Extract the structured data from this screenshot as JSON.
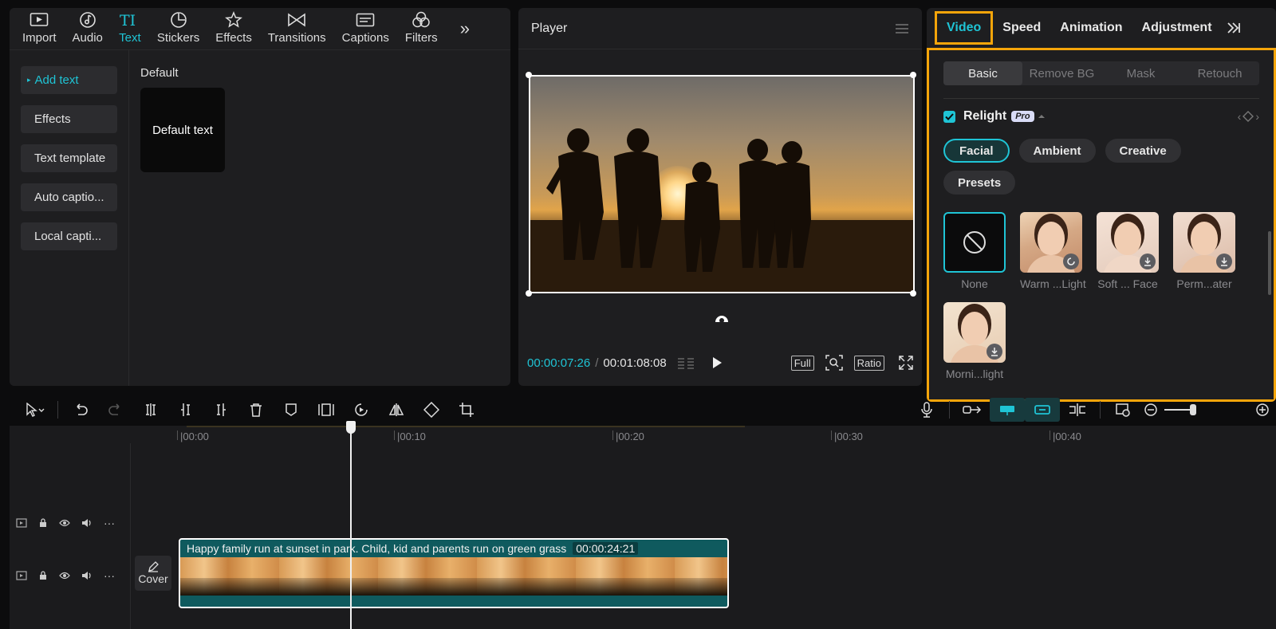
{
  "media": {
    "tabs": [
      {
        "label": "Import",
        "icon": "import-icon"
      },
      {
        "label": "Audio",
        "icon": "audio-icon"
      },
      {
        "label": "Text",
        "icon": "text-icon"
      },
      {
        "label": "Stickers",
        "icon": "stickers-icon"
      },
      {
        "label": "Effects",
        "icon": "effects-icon"
      },
      {
        "label": "Transitions",
        "icon": "transitions-icon"
      },
      {
        "label": "Captions",
        "icon": "captions-icon"
      },
      {
        "label": "Filters",
        "icon": "filters-icon"
      }
    ],
    "active_tab": "Text",
    "sidebar": [
      "Add text",
      "Effects",
      "Text template",
      "Auto captio...",
      "Local capti..."
    ],
    "section_label": "Default",
    "card_label": "Default text"
  },
  "player": {
    "title": "Player",
    "current_time": "00:00:07:26",
    "total_time": "00:01:08:08",
    "full_label": "Full",
    "ratio_label": "Ratio"
  },
  "properties": {
    "tabs": [
      "Video",
      "Speed",
      "Animation",
      "Adjustment"
    ],
    "active_tab": "Video",
    "sub_tabs": [
      "Basic",
      "Remove BG",
      "Mask",
      "Retouch"
    ],
    "active_sub_tab": "Basic",
    "relight_label": "Relight",
    "pro_label": "Pro",
    "relight_enabled": true,
    "chips": [
      "Facial",
      "Ambient",
      "Creative",
      "Presets"
    ],
    "active_chip": "Facial",
    "presets": [
      {
        "label": "None",
        "icon": "none-icon"
      },
      {
        "label": "Warm ...Light",
        "icon": "loading-icon"
      },
      {
        "label": "Soft ... Face",
        "icon": "download-icon"
      },
      {
        "label": "Perm...ater",
        "icon": "download-icon"
      },
      {
        "label": "Morni...light",
        "icon": "download-icon"
      }
    ],
    "accent_color": "#1fc4d5",
    "highlight_color": "#f5a50a"
  },
  "timeline": {
    "ruler": [
      "|00:00",
      "|00:10",
      "|00:20",
      "|00:30",
      "|00:40"
    ],
    "cover_label": "Cover",
    "clip_title": "Happy family run at sunset in park. Child, kid and parents run on green grass",
    "clip_duration": "00:00:24:21"
  }
}
